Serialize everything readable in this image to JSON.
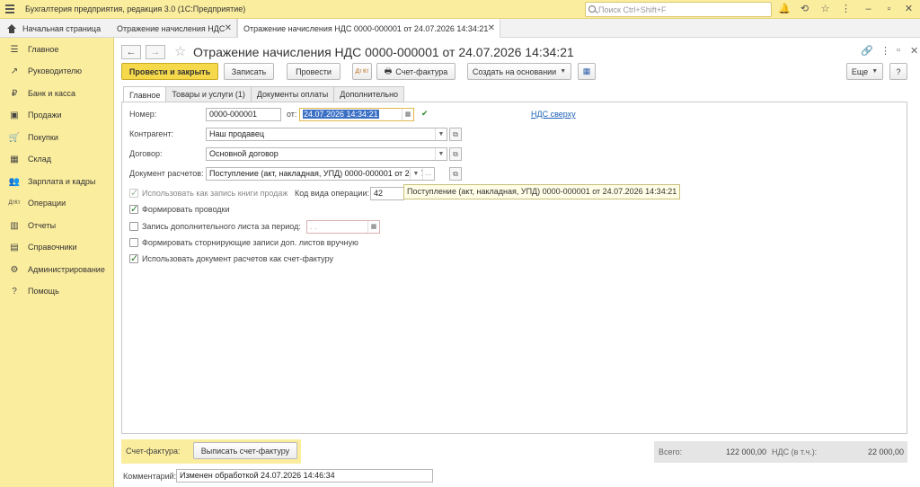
{
  "app": {
    "title": "Бухгалтерия предприятия, редакция 3.0  (1С:Предприятие)",
    "search_placeholder": "Поиск Ctrl+Shift+F"
  },
  "tabs": {
    "home": "Начальная страница",
    "items": [
      {
        "label": "Отражение начисления НДС"
      },
      {
        "label": "Отражение начисления НДС 0000-000001 от 24.07.2026 14:34:21"
      }
    ]
  },
  "sidebar": {
    "items": [
      {
        "label": "Главное",
        "icon": "menu-icon"
      },
      {
        "label": "Руководителю",
        "icon": "trend-icon"
      },
      {
        "label": "Банк и касса",
        "icon": "coin-icon"
      },
      {
        "label": "Продажи",
        "icon": "bag-icon"
      },
      {
        "label": "Покупки",
        "icon": "cart-icon"
      },
      {
        "label": "Склад",
        "icon": "warehouse-icon"
      },
      {
        "label": "Зарплата и кадры",
        "icon": "people-icon"
      },
      {
        "label": "Операции",
        "icon": "dt-kt-icon"
      },
      {
        "label": "Отчеты",
        "icon": "chart-icon"
      },
      {
        "label": "Справочники",
        "icon": "book-icon"
      },
      {
        "label": "Администрирование",
        "icon": "gear-icon"
      },
      {
        "label": "Помощь",
        "icon": "help-icon"
      }
    ]
  },
  "document": {
    "title": "Отражение начисления НДС 0000-000001 от 24.07.2026 14:34:21"
  },
  "toolbar": {
    "post_close": "Провести и закрыть",
    "save": "Записать",
    "post": "Провести",
    "invoice": "Счет-фактура",
    "create_based": "Создать на основании",
    "more": "Еще",
    "help": "?",
    "dtkt": "Дт Кт"
  },
  "subtabs": [
    "Главное",
    "Товары и услуги (1)",
    "Документы оплаты",
    "Дополнительно"
  ],
  "form": {
    "number_label": "Номер:",
    "number_value": "0000-000001",
    "from_label": "от:",
    "date_value": "24.07.2026 14:34:21",
    "vat_link": "НДС сверху",
    "counterparty_label": "Контрагент:",
    "counterparty_value": "Наш продавец",
    "contract_label": "Договор:",
    "contract_value": "Основной договор",
    "settlement_label": "Документ расчетов:",
    "settlement_value": "Поступление (акт, накладная, УПД) 0000-000001 от 24.07",
    "use_sales_book": "Использовать как запись книги продаж",
    "op_code_label": "Код вида операции:",
    "op_code_value": "42",
    "tooltip": "Поступление (акт, накладная, УПД) 0000-000001 от 24.07.2026 14:34:21",
    "make_postings": "Формировать проводки",
    "extra_sheet": "Запись дополнительного листа за период:",
    "extra_sheet_value": " .  .",
    "storno": "Формировать сторнирующие записи доп. листов вручную",
    "use_as_invoice": "Использовать документ расчетов как счет-фактуру"
  },
  "footer": {
    "invoice_label": "Счет-фактура:",
    "issue_invoice": "Выписать счет-фактуру",
    "total_label": "Всего:",
    "total_value": "122 000,00",
    "vat_label": "НДС (в т.ч.):",
    "vat_value": "22 000,00",
    "comment_label": "Комментарий:",
    "comment_value": "Изменен обработкой 24.07.2026 14:46:34"
  }
}
